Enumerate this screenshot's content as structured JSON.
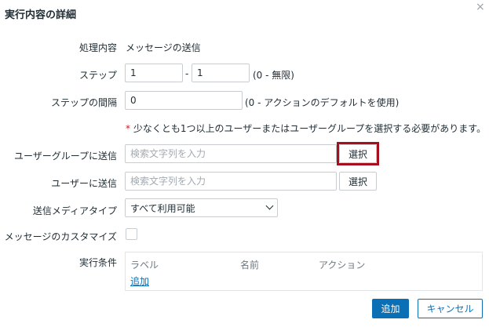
{
  "dialog": {
    "title": "実行内容の詳細",
    "close_icon": "×"
  },
  "form": {
    "operation": {
      "label": "処理内容",
      "value": "メッセージの送信"
    },
    "steps": {
      "label": "ステップ",
      "from": "1",
      "separator": "-",
      "to": "1",
      "hint": "(0 - 無限)"
    },
    "step_duration": {
      "label": "ステップの間隔",
      "value": "0",
      "hint": "(0 - アクションのデフォルトを使用)"
    },
    "required_note": "少なくとも1つ以上のユーザーまたはユーザーグループを選択する必要があります。",
    "required_mark": "*",
    "user_groups": {
      "label": "ユーザーグループに送信",
      "placeholder": "検索文字列を入力",
      "select_label": "選択"
    },
    "users": {
      "label": "ユーザーに送信",
      "placeholder": "検索文字列を入力",
      "select_label": "選択"
    },
    "media_type": {
      "label": "送信メディアタイプ",
      "selected": "すべて利用可能"
    },
    "custom_message": {
      "label": "メッセージのカスタマイズ",
      "checked": false
    },
    "conditions": {
      "label": "実行条件",
      "columns": [
        "ラベル",
        "名前",
        "アクション"
      ],
      "add_link": "追加"
    }
  },
  "footer": {
    "add_label": "追加",
    "cancel_label": "キャンセル"
  },
  "colors": {
    "primary": "#0a6fb5",
    "highlight": "#a50f1e",
    "required": "#d11a1a"
  }
}
